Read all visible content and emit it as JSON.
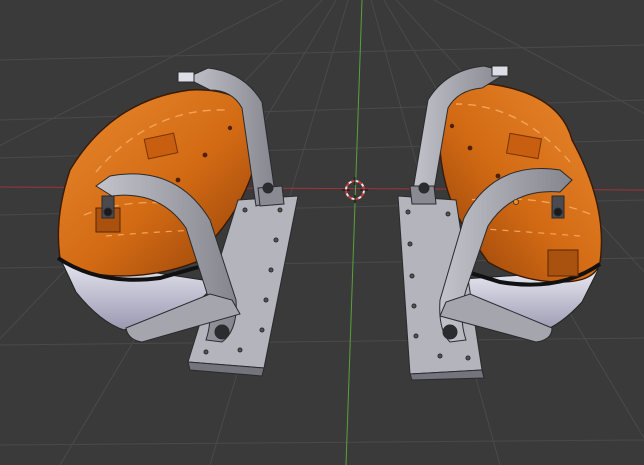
{
  "viewport": {
    "name": "3D Viewport",
    "background_color": "#3a3a3a",
    "grid_color": "#4a4a4a",
    "x_axis_color": "#a0343a",
    "y_axis_color": "#5aa03c"
  },
  "scene": {
    "objects": [
      {
        "name": "lifeboat-left",
        "hull_color": "#d26a14",
        "base_color": "#c9c9d6"
      },
      {
        "name": "lifeboat-right",
        "hull_color": "#d26a14",
        "base_color": "#c9c9d6"
      },
      {
        "name": "davit-left",
        "color": "#9a9aa3"
      },
      {
        "name": "davit-right",
        "color": "#9a9aa3"
      }
    ],
    "cursor_icon": "3d-cursor-icon",
    "origin_icon": "object-origin-icon"
  }
}
